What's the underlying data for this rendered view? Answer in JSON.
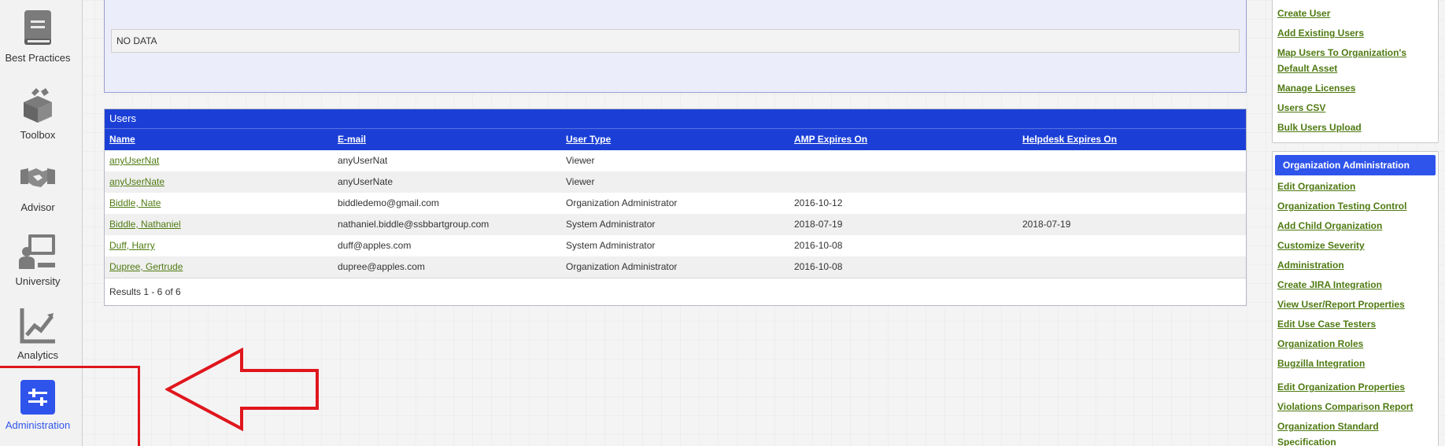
{
  "nav": {
    "items": [
      {
        "label": "Best Practices"
      },
      {
        "label": "Toolbox"
      },
      {
        "label": "Advisor"
      },
      {
        "label": "University"
      },
      {
        "label": "Analytics"
      },
      {
        "label": "Administration"
      }
    ],
    "accent": "#2f54eb"
  },
  "top_panel": {
    "nodata_text": "NO DATA"
  },
  "users": {
    "title": "Users",
    "columns": [
      "Name",
      "E-mail",
      "User Type",
      "AMP Expires On",
      "Helpdesk Expires On"
    ],
    "rows": [
      [
        "anyUserNat",
        "anyUserNat",
        "Viewer",
        "",
        ""
      ],
      [
        "anyUserNate",
        "anyUserNate",
        "Viewer",
        "",
        ""
      ],
      [
        "Biddle, Nate",
        "biddledemo@gmail.com",
        "Organization Administrator",
        "2016-10-12",
        ""
      ],
      [
        "Biddle, Nathaniel",
        "nathaniel.biddle@ssbbartgroup.com",
        "System Administrator",
        "2018-07-19",
        "2018-07-19"
      ],
      [
        "Duff, Harry",
        "duff@apples.com",
        "System Administrator",
        "2016-10-08",
        ""
      ],
      [
        "Dupree, Gertrude",
        "dupree@apples.com",
        "Organization Administrator",
        "2016-10-08",
        ""
      ]
    ],
    "results_text": "Results 1 - 6 of 6",
    "header_color": "#1b3fd6",
    "link_color": "#4f7a12"
  },
  "sidebar": {
    "user_links": [
      "Create User",
      "Add Existing Users",
      "Map Users To Organization's Default Asset",
      "Manage Licenses",
      "Users CSV",
      "Bulk Users Upload"
    ],
    "org_admin_title": "Organization Administration",
    "org_admin_links": [
      "Edit Organization",
      "Organization Testing Control",
      "Add Child Organization",
      "Customize Severity",
      "Administration",
      "Create JIRA Integration",
      "View User/Report Properties",
      "Edit Use Case Testers",
      "Organization Roles",
      "Bugzilla Integration",
      "Edit Organization Properties",
      "Violations Comparison Report",
      "Organization Standard Specification"
    ]
  },
  "annotation_color": "#e0161d"
}
